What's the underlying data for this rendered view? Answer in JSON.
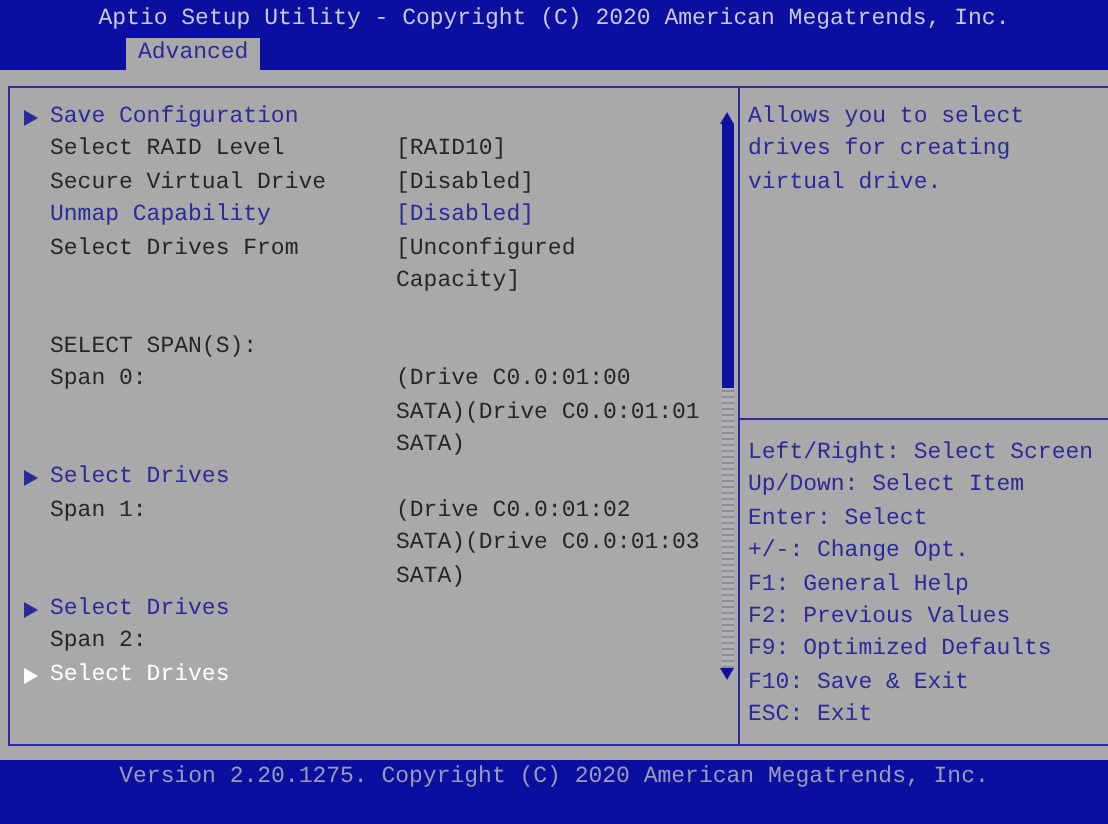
{
  "title": "Aptio Setup Utility - Copyright (C) 2020 American Megatrends, Inc.",
  "tabs": [
    {
      "label": "Advanced",
      "selected": true
    }
  ],
  "items": [
    {
      "kind": "submenu",
      "label": "Save Configuration",
      "selected": false
    },
    {
      "kind": "setting",
      "label": "Select RAID Level",
      "value": "[RAID10]",
      "disabled": true
    },
    {
      "kind": "setting",
      "label": "Secure Virtual Drive",
      "value": "[Disabled]",
      "disabled": true
    },
    {
      "kind": "setting",
      "label": "Unmap Capability",
      "value": "[Disabled]",
      "disabled": false
    },
    {
      "kind": "setting",
      "label": "Select Drives From",
      "value": "[Unconfigured Capacity]",
      "disabled": true
    },
    {
      "kind": "heading",
      "label": "SELECT SPAN(S):"
    },
    {
      "kind": "setting",
      "label": "Span 0:",
      "value": "(Drive C0.0:01:00 SATA)(Drive C0.0:01:01 SATA)",
      "disabled": true
    },
    {
      "kind": "submenu",
      "label": "Select Drives",
      "selected": false
    },
    {
      "kind": "setting",
      "label": "Span 1:",
      "value": "(Drive C0.0:01:02 SATA)(Drive C0.0:01:03 SATA)",
      "disabled": true
    },
    {
      "kind": "submenu",
      "label": "Select Drives",
      "selected": false
    },
    {
      "kind": "setting",
      "label": "Span 2:",
      "disabled": true
    },
    {
      "kind": "submenu",
      "label": "Select Drives",
      "selected": true
    }
  ],
  "help": {
    "description": "Allows you to select drives for creating virtual drive.",
    "keys": [
      "Left/Right: Select Screen",
      "Up/Down: Select Item",
      "Enter: Select",
      "+/-: Change Opt.",
      "F1: General Help",
      "F2: Previous Values",
      "F9: Optimized Defaults",
      "F10: Save & Exit",
      "ESC: Exit"
    ]
  },
  "footer": "Version 2.20.1275. Copyright (C) 2020 American Megatrends, Inc."
}
